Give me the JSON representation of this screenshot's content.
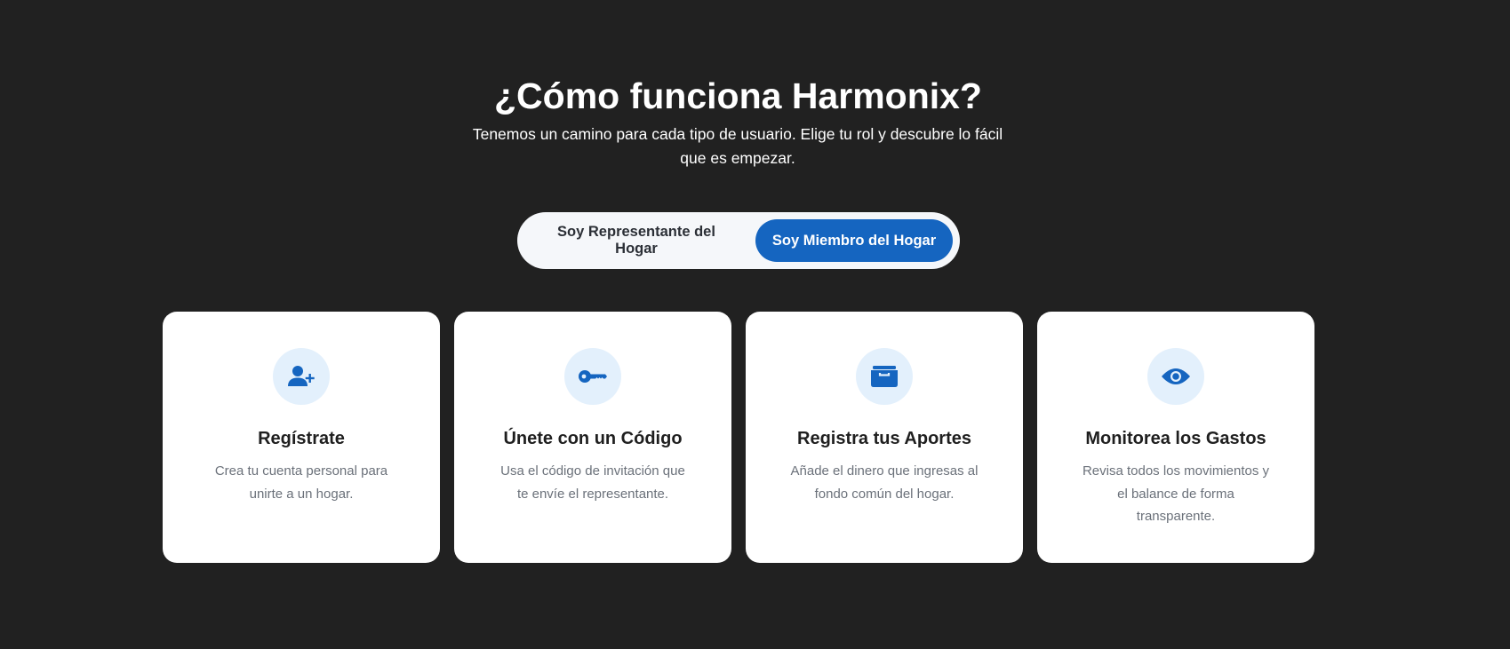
{
  "header": {
    "title": "¿Cómo funciona Harmonix?",
    "subtitle": "Tenemos un camino para cada tipo de usuario. Elige tu rol y descubre lo fácil que es empezar."
  },
  "role_toggle": {
    "representative_label": "Soy Representante del Hogar",
    "member_label": "Soy Miembro del Hogar",
    "selected": "member"
  },
  "steps": [
    {
      "icon": "user-plus-icon",
      "title": "Regístrate",
      "description": "Crea tu cuenta personal para unirte a un hogar."
    },
    {
      "icon": "key-icon",
      "title": "Únete con un Código",
      "description": "Usa el código de invitación que te envíe el representante."
    },
    {
      "icon": "wallet-icon",
      "title": "Registra tus Aportes",
      "description": "Añade el dinero que ingresas al fondo común del hogar."
    },
    {
      "icon": "eye-icon",
      "title": "Monitorea los Gastos",
      "description": "Revisa todos los movimientos y el balance de forma transparente."
    }
  ],
  "colors": {
    "background": "#212121",
    "accent": "#1565c0",
    "icon_bg": "#e3f0fc",
    "card_bg": "#ffffff",
    "muted_text": "#6b717a"
  }
}
